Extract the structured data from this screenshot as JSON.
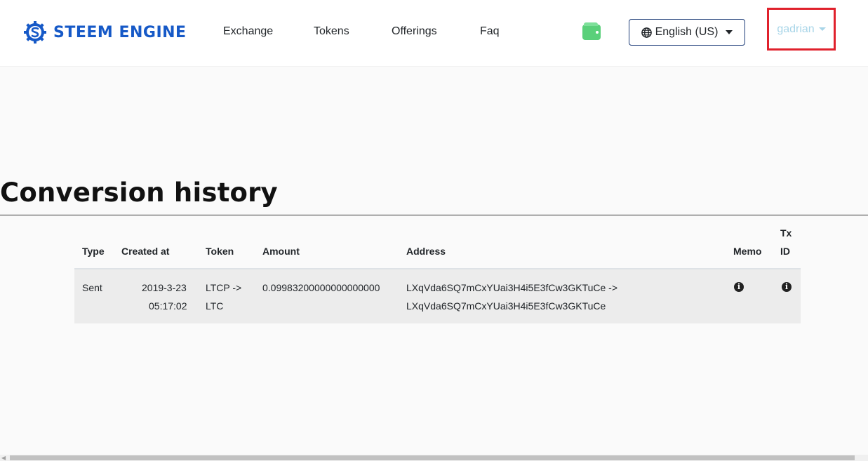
{
  "brand": {
    "name": "STEEM ENGINE",
    "color": "#1659c7"
  },
  "nav": {
    "items": [
      {
        "label": "Exchange"
      },
      {
        "label": "Tokens"
      },
      {
        "label": "Offerings"
      },
      {
        "label": "Faq"
      }
    ],
    "language": "English (US)",
    "user": "gadrian"
  },
  "page": {
    "title": "Conversion history"
  },
  "table": {
    "headers": {
      "type": "Type",
      "created_at": "Created at",
      "token": "Token",
      "amount": "Amount",
      "address": "Address",
      "memo": "Memo",
      "tx_id_line1": "Tx",
      "tx_id_line2": "ID"
    },
    "rows": [
      {
        "type": "Sent",
        "date": "2019-3-23",
        "time": "05:17:02",
        "token_line1": "LTCP ->",
        "token_line2": "LTC",
        "amount": "0.09983200000000000000",
        "address_line1": "LXqVda6SQ7mCxYUai3H4i5E3fCw3GKTuCe ->",
        "address_line2": "LXqVda6SQ7mCxYUai3H4i5E3fCw3GKTuCe",
        "memo_icon": "info-icon",
        "txid_icon": "info-icon"
      }
    ]
  },
  "colors": {
    "highlight_border": "#e0212c",
    "row_bg": "#ececec",
    "wallet": "#5ad07a"
  }
}
